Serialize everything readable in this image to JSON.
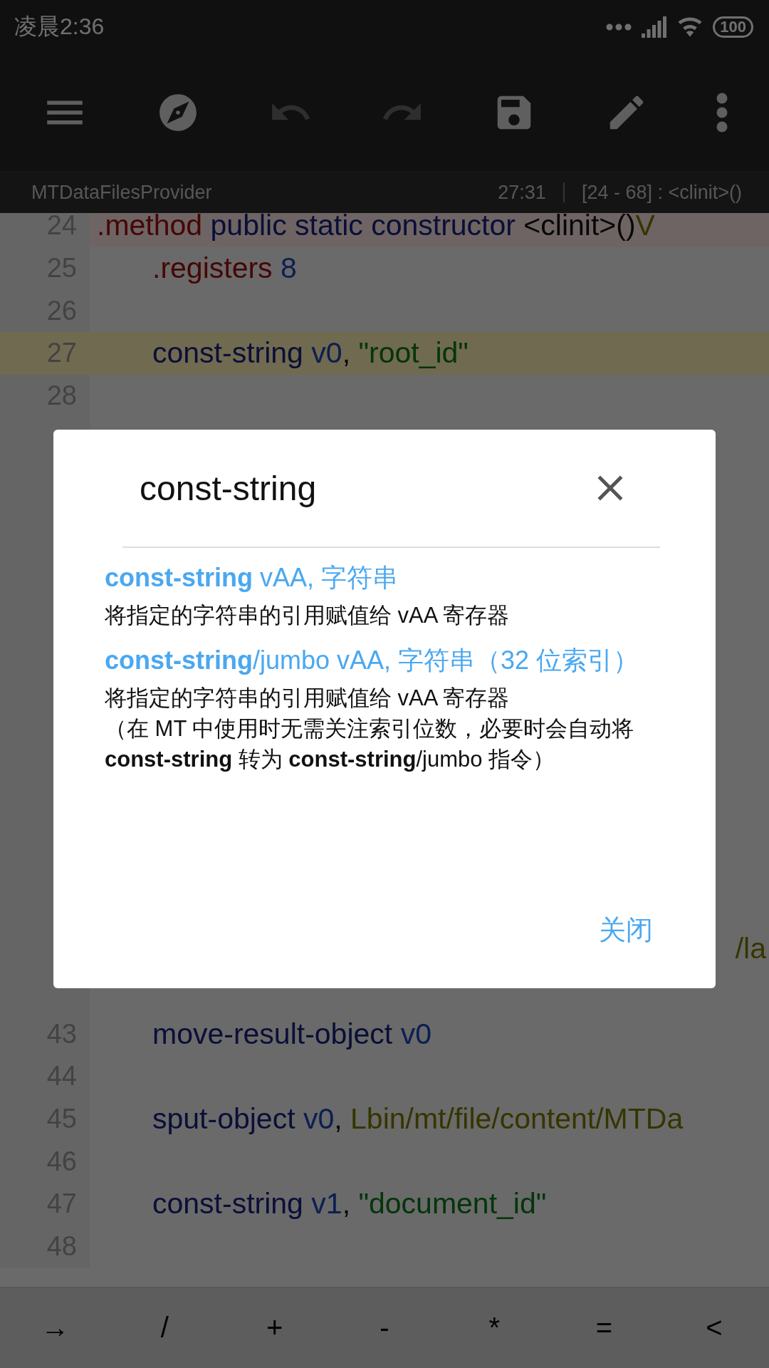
{
  "status_bar": {
    "time": "凌晨2:36",
    "battery": "100"
  },
  "toolbar": {
    "buttons": [
      {
        "kind": "menu",
        "disabled": false
      },
      {
        "kind": "compass",
        "disabled": false
      },
      {
        "kind": "undo",
        "disabled": true
      },
      {
        "kind": "redo",
        "disabled": true
      },
      {
        "kind": "save",
        "disabled": false
      },
      {
        "kind": "edit",
        "disabled": false
      },
      {
        "kind": "more",
        "disabled": false
      }
    ]
  },
  "info_bar": {
    "file": "MTDataFilesProvider",
    "cursor": "27:31",
    "range": "[24 - 68] : <clinit>()"
  },
  "editor": {
    "lines": [
      {
        "number": "24",
        "kind": "method",
        "selected": false,
        "tokens": [
          {
            "text": ".method",
            "kind": "directive"
          },
          {
            "text": " public static constructor ",
            "kind": "keyword"
          },
          {
            "text": "<clinit>()",
            "kind": "plain"
          },
          {
            "text": "V",
            "kind": "type"
          }
        ]
      },
      {
        "number": "25",
        "kind": "body",
        "selected": false,
        "tokens": [
          {
            "text": ".registers",
            "kind": "directive"
          },
          {
            "text": " 8",
            "kind": "number"
          }
        ]
      },
      {
        "number": "26",
        "kind": "body",
        "selected": false
      },
      {
        "number": "27",
        "kind": "body",
        "selected": true,
        "tokens": [
          {
            "text": "const-string",
            "kind": "keyword"
          },
          {
            "text": " v0",
            "kind": "register"
          },
          {
            "text": ", ",
            "kind": "plain"
          },
          {
            "text": "\"root_id\"",
            "kind": "string"
          }
        ]
      },
      {
        "number": "28",
        "kind": "body",
        "selected": false
      },
      {
        "kind": "covered",
        "selected": false
      },
      {
        "kind": "clipped",
        "selected": false,
        "tokens": [
          {
            "text": "/la",
            "kind": "type"
          }
        ]
      },
      {
        "number": "43",
        "kind": "body",
        "selected": false,
        "tokens": [
          {
            "text": "move-result-object",
            "kind": "keyword"
          },
          {
            "text": " v0",
            "kind": "register"
          }
        ]
      },
      {
        "number": "44",
        "kind": "body",
        "selected": false
      },
      {
        "number": "45",
        "kind": "body",
        "selected": false,
        "tokens": [
          {
            "text": "sput-object",
            "kind": "keyword"
          },
          {
            "text": " v0",
            "kind": "register"
          },
          {
            "text": ", ",
            "kind": "plain"
          },
          {
            "text": "Lbin/mt/file/content/MTDa",
            "kind": "type"
          }
        ]
      },
      {
        "number": "46",
        "kind": "body",
        "selected": false
      },
      {
        "number": "47",
        "kind": "body",
        "selected": false,
        "tokens": [
          {
            "text": "const-string",
            "kind": "keyword"
          },
          {
            "text": " v1",
            "kind": "register"
          },
          {
            "text": ", ",
            "kind": "plain"
          },
          {
            "text": "\"document_id\"",
            "kind": "string"
          }
        ]
      },
      {
        "number": "48",
        "kind": "body",
        "selected": false
      }
    ]
  },
  "dialog": {
    "title": "const-string",
    "entries": [
      {
        "heading": "**const-string** vAA, 字符串",
        "description": [
          "将指定的字符串的引用赋值给 vAA 寄存器"
        ]
      },
      {
        "heading": "**const-string**/jumbo vAA, 字符串（32 位索引）",
        "description": [
          "将指定的字符串的引用赋值给 vAA 寄存器",
          "（在 MT 中使用时无需关注索引位数，必要时会自动将 **const-string** 转为 **const-string**/jumbo 指令）"
        ]
      }
    ],
    "button": "关闭"
  },
  "keys": [
    "→",
    "/",
    "+",
    "-",
    "*",
    "=",
    "<"
  ]
}
